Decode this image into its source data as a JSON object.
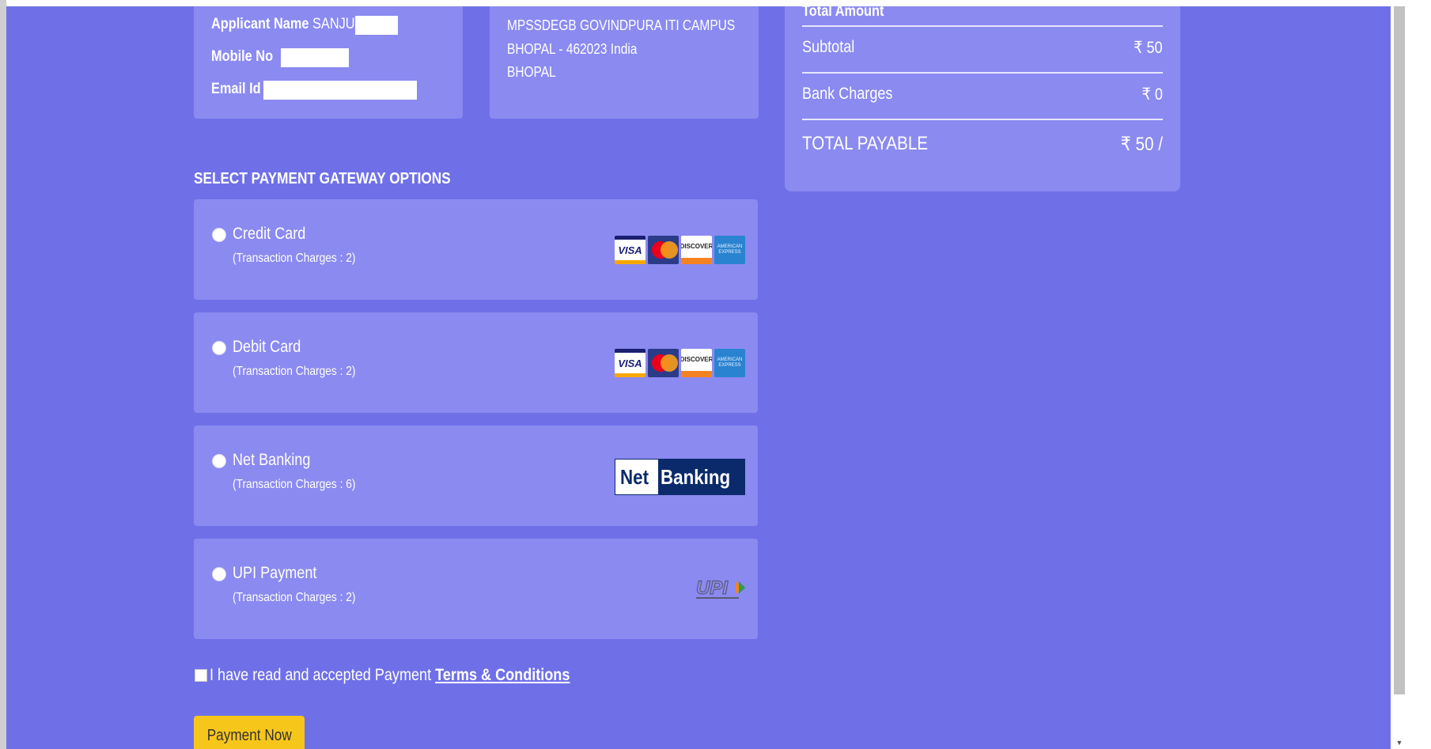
{
  "applicant": {
    "name_label": "Applicant Name",
    "name_value": "SANJU",
    "mobile_label": "Mobile No",
    "email_label": "Email Id"
  },
  "address": {
    "line1": "MPSSDEGB GOVINDPURA ITI CAMPUS",
    "line2": "BHOPAL - 462023 India",
    "line3": "BHOPAL"
  },
  "summary": {
    "heading": "Total Amount",
    "subtotal_label": "Subtotal",
    "subtotal_value": "₹ 50",
    "bank_charges_label": "Bank Charges",
    "bank_charges_value": "₹ 0",
    "total_label": "TOTAL PAYABLE",
    "total_value": "₹ 50 /"
  },
  "gateway": {
    "heading": "SELECT PAYMENT GATEWAY OPTIONS",
    "options": [
      {
        "label": "Credit Card",
        "charges": "(Transaction Charges : 2)",
        "logo": "visa-mastercard-discover-amex-logo"
      },
      {
        "label": "Debit Card",
        "charges": "(Transaction Charges : 2)",
        "logo": "visa-mastercard-discover-amex-logo"
      },
      {
        "label": "Net Banking",
        "charges": "(Transaction Charges : 6)",
        "logo": "net-banking-logo"
      },
      {
        "label": "UPI Payment",
        "charges": "(Transaction Charges : 2)",
        "logo": "upi-logo"
      }
    ]
  },
  "logos": {
    "visa": "VISA",
    "discover": "DISCOVER",
    "amex": "AMERICAN EXPRESS",
    "net": "Net",
    "banking": "Banking",
    "upi": "UPI"
  },
  "terms": {
    "text": "I have read and accepted Payment",
    "link": "Terms & Conditions"
  },
  "pay_button": "Payment Now",
  "colors": {
    "page_bg": "#6f70e8",
    "card_bg": "#8b8af0",
    "button_bg": "#f7c61b"
  }
}
